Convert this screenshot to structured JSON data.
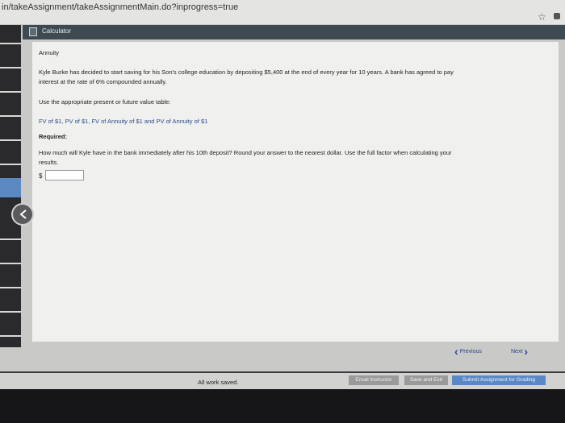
{
  "browser": {
    "url": "in/takeAssignment/takeAssignmentMain.do?inprogress=true",
    "star_icon": "star-icon"
  },
  "window": {
    "title": "Calculator"
  },
  "question": {
    "heading": "Annuity",
    "body_line1": "Kyle Burke has decided to start saving for his Son's college education by depositing $5,400 at the end of every year for 10 years. A bank has agreed to pay",
    "body_line2": "interest at the rate of 6% compounded annually.",
    "instruction": "Use the appropriate present or future value table:",
    "table_links": "FV of $1, PV of $1, FV of Annuity of $1 and PV of Annuity of $1",
    "required_label": "Required:",
    "required_line1": "How much will Kyle have in the bank immediately after his 10th deposit? Round your answer to the nearest dollar. Use the full factor when calculating your",
    "required_line2": "results.",
    "currency_symbol": "$",
    "answer_value": ""
  },
  "navigation": {
    "previous_label": "Previous",
    "next_label": "Next"
  },
  "footer": {
    "status": "All work saved.",
    "email_label": "Email Instructor",
    "save_exit_label": "Save and Exit",
    "submit_label": "Submit Assignment for Grading"
  },
  "colors": {
    "titlebar": "#3d4a52",
    "link_blue": "#2d4a8a",
    "submit_blue": "#5a88c6"
  }
}
